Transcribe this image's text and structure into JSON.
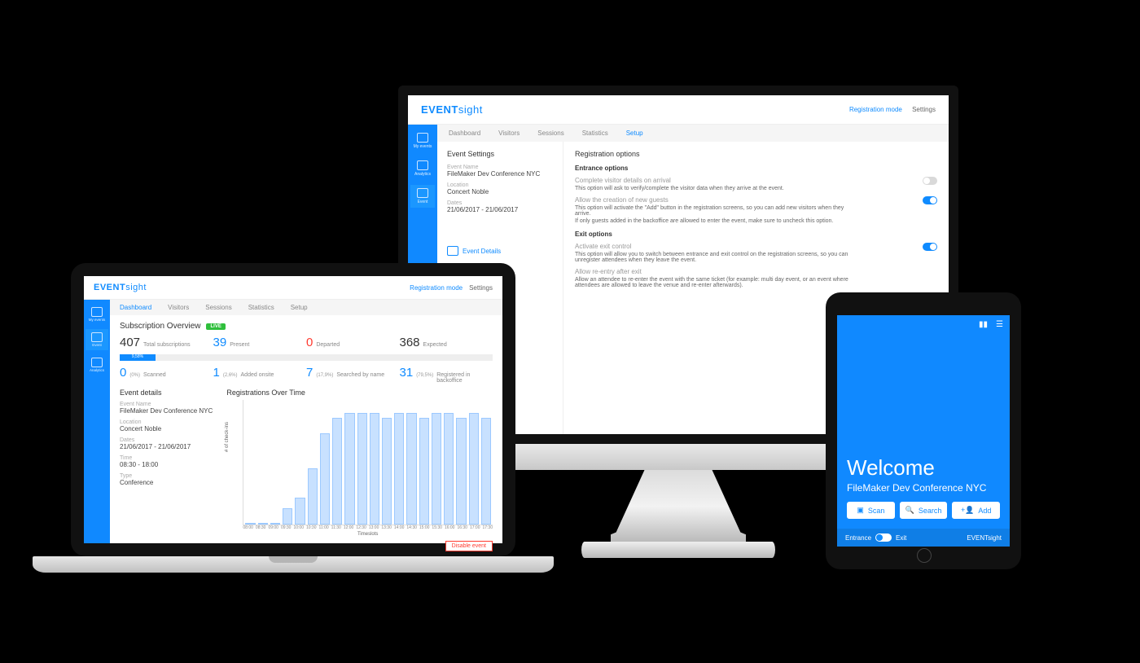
{
  "brand": {
    "bold": "EVENT",
    "light": "sight"
  },
  "colors": {
    "accent": "#0f8bff",
    "danger": "#ff3b30",
    "success": "#2fbf3c"
  },
  "header_links": {
    "reg_mode": "Registration mode",
    "settings": "Settings"
  },
  "sidebar": {
    "items": [
      "My events",
      "Analytics",
      "Event"
    ]
  },
  "desktop": {
    "tabs": [
      "Dashboard",
      "Visitors",
      "Sessions",
      "Statistics",
      "Setup"
    ],
    "active_tab": 4,
    "left_title": "Event Settings",
    "event": {
      "name_label": "Event Name",
      "name": "FileMaker Dev Conference NYC",
      "location_label": "Location",
      "location": "Concert Noble",
      "dates_label": "Dates",
      "dates": "21/06/2017 - 21/06/2017"
    },
    "footer_item": "Event Details",
    "right_title": "Registration options",
    "sections": {
      "entrance": {
        "title": "Entrance options",
        "opt1_t": "Complete visitor details on arrival",
        "opt1_d": "This option will ask to verify/complete the visitor data when they arrive at the event.",
        "opt1_on": false,
        "opt2_t": "Allow the creation of new guests",
        "opt2_d1": "This option will activate the \"Add\" button in the registration screens, so you can add new visitors when they arrive.",
        "opt2_d2": "If only guests added in the backoffice are allowed to enter the event, make sure to uncheck this option.",
        "opt2_on": true
      },
      "exit": {
        "title": "Exit options",
        "opt1_t": "Activate exit control",
        "opt1_d": "This option will allow you to switch between entrance and exit control on the registration screens, so you can unregister attendees when they leave the event.",
        "opt1_on": true,
        "opt2_t": "Allow re-entry after exit",
        "opt2_d": "Allow an attendee to re-enter the event with the same ticket (for example: multi day event, or an event where attendees are allowed to leave the venue and re-enter afterwards)."
      }
    }
  },
  "laptop": {
    "tabs": [
      "Dashboard",
      "Visitors",
      "Sessions",
      "Statistics",
      "Setup"
    ],
    "active_tab": 0,
    "overview_title": "Subscription Overview",
    "badge": "LIVE",
    "stats1": [
      {
        "n": "407",
        "l": "Total subscriptions",
        "cls": "c-dark"
      },
      {
        "n": "39",
        "l": "Present",
        "cls": "c-blue"
      },
      {
        "n": "0",
        "l": "Departed",
        "cls": "c-red"
      },
      {
        "n": "368",
        "l": "Expected",
        "cls": "c-dark"
      }
    ],
    "progress_label": "9,58%",
    "stats2": [
      {
        "n": "0",
        "p": "(0%)",
        "l": "Scanned"
      },
      {
        "n": "1",
        "p": "(2,6%)",
        "l": "Added onsite"
      },
      {
        "n": "7",
        "p": "(17,9%)",
        "l": "Searched by name"
      },
      {
        "n": "31",
        "p": "(79,5%)",
        "l": "Registered in backoffice"
      }
    ],
    "event_details_title": "Event details",
    "event": {
      "name_label": "Event Name",
      "name": "FileMaker Dev Conference NYC",
      "location_label": "Location",
      "location": "Concert Noble",
      "dates_label": "Dates",
      "dates": "21/06/2017 - 21/06/2017",
      "time_label": "Time",
      "time": "08:30 - 18:00",
      "type_label": "Type",
      "type": "Conference"
    },
    "chart_title": "Registrations Over Time",
    "disable_btn": "Disable event"
  },
  "tablet": {
    "welcome": "Welcome",
    "subtitle": "FileMaker Dev Conference NYC",
    "buttons": {
      "scan": "Scan",
      "search": "Search",
      "add": "Add"
    },
    "footer": {
      "entrance": "Entrance",
      "exit": "Exit",
      "brand": "EVENTsight"
    }
  },
  "chart_data": {
    "type": "bar",
    "title": "Registrations Over Time",
    "ylabel": "# of check-ins",
    "xlabel": "Timeslots",
    "ylim": [
      0,
      25
    ],
    "categories": [
      "08:00",
      "08:30",
      "09:00",
      "09:30",
      "10:00",
      "10:30",
      "11:00",
      "11:30",
      "12:00",
      "12:30",
      "13:00",
      "13:30",
      "14:00",
      "14:30",
      "15:00",
      "15:30",
      "16:00",
      "16:30",
      "17:00",
      "17:30"
    ],
    "values": [
      0,
      0,
      0,
      3,
      5,
      11,
      18,
      21,
      22,
      22,
      22,
      21,
      22,
      22,
      21,
      22,
      22,
      21,
      22,
      21
    ]
  }
}
